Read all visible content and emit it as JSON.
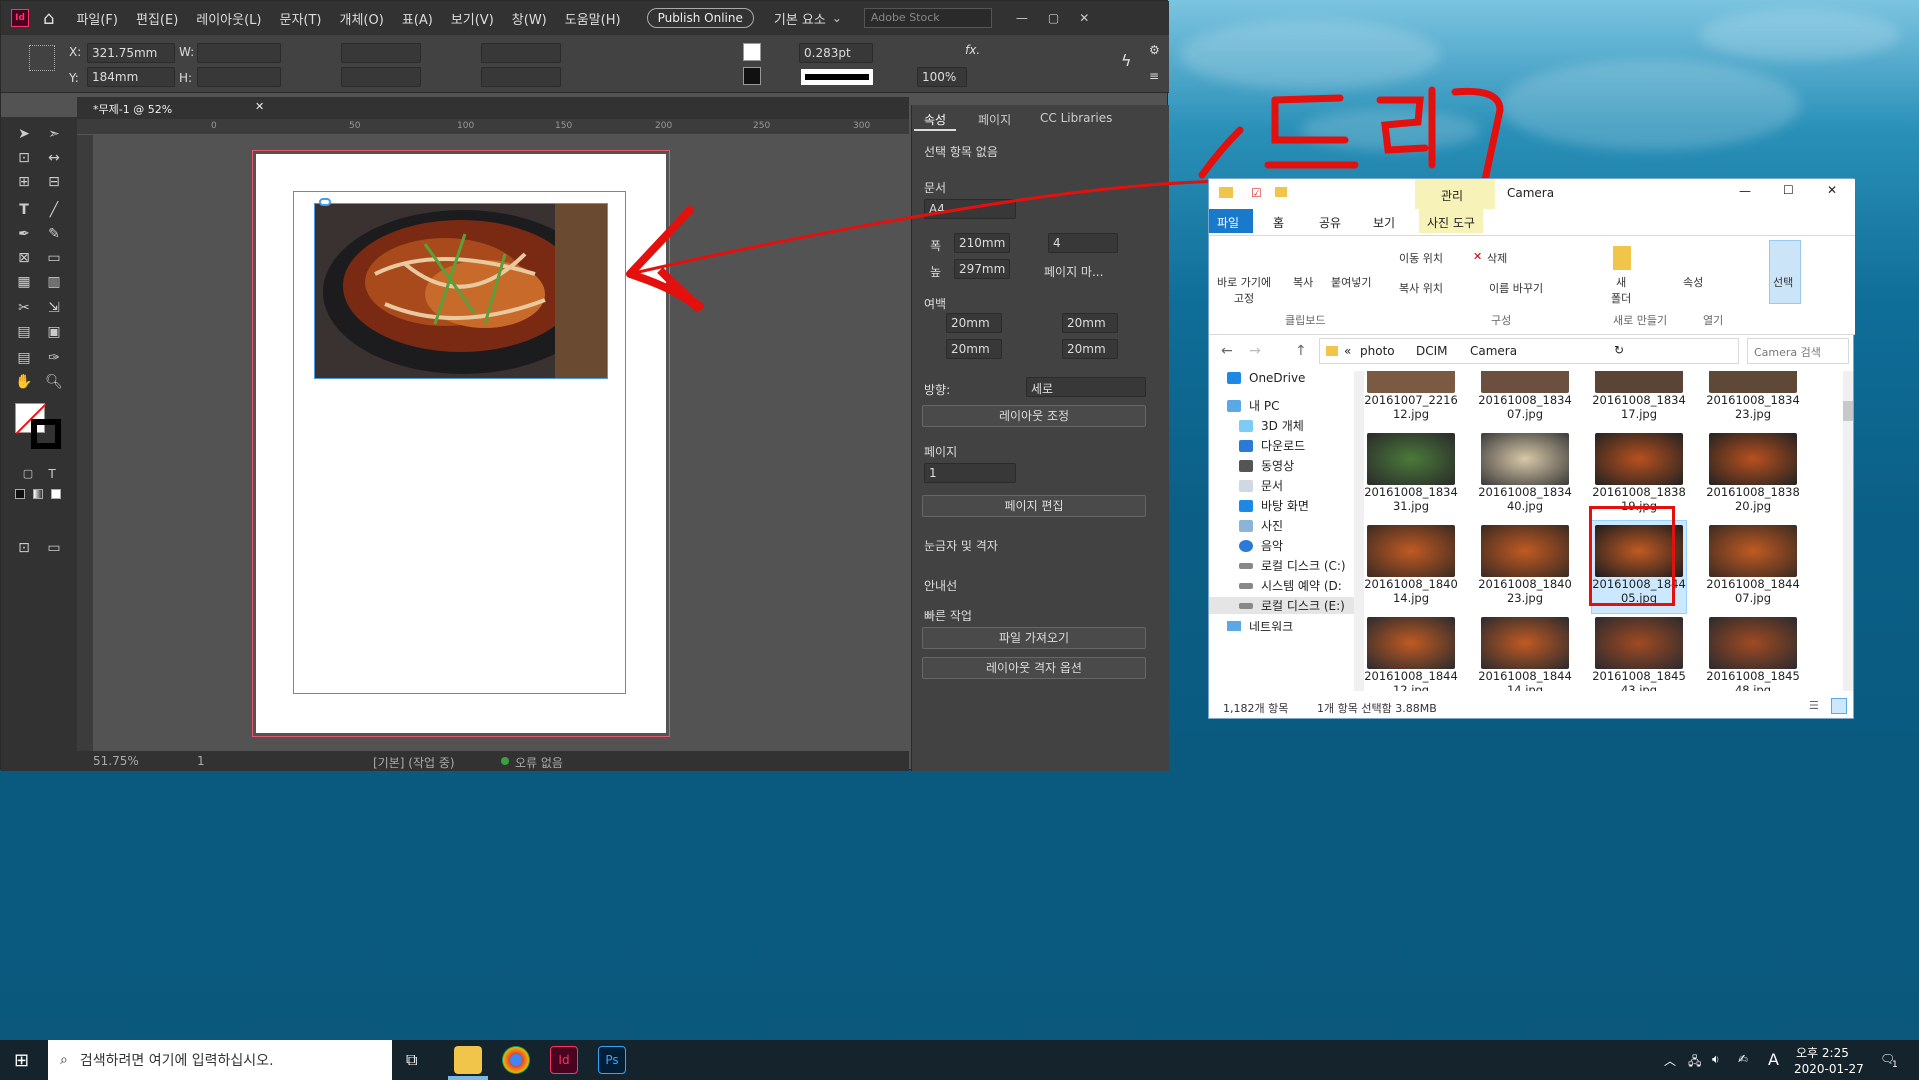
{
  "desktop": {
    "annotation": "드레그"
  },
  "indesign": {
    "menu": [
      "파일(F)",
      "편집(E)",
      "레이아웃(L)",
      "문자(T)",
      "개체(O)",
      "표(A)",
      "보기(V)",
      "창(W)",
      "도움말(H)"
    ],
    "publish": "Publish Online",
    "workspace": "기본 요소",
    "stock_search": "Adobe Stock",
    "control": {
      "x": "321.75mm",
      "y": "184mm",
      "w_label": "W:",
      "h_label": "H:",
      "x_label": "X:",
      "y_label": "Y:",
      "stroke": "0.283pt",
      "zoom": "100%"
    },
    "doc_tab": "*무제-1 @ 52%",
    "ruler_marks": [
      "0",
      "50",
      "100",
      "150",
      "200",
      "250",
      "300"
    ],
    "status": {
      "zoom": "51.75%",
      "page": "1",
      "style": "[기본] (작업 중)",
      "errors": "오류 없음"
    },
    "panel": {
      "tabs": [
        "속성",
        "페이지",
        "CC Libraries"
      ],
      "no_selection": "선택 항목 없음",
      "document": "문서",
      "size": "A4",
      "width_label": "폭",
      "width": "210mm",
      "height_label": "높",
      "height": "297mm",
      "pages_count": "4",
      "facing": "페이지 마...",
      "margins": "여백",
      "margin_values": [
        "20mm",
        "20mm",
        "20mm",
        "20mm"
      ],
      "orientation_label": "방향:",
      "orientation": "세로",
      "adjust_layout": "레이아웃 조정",
      "page_section": "페이지",
      "page_num": "1",
      "edit_page": "페이지 편집",
      "rulers_grids": "눈금자 및 격자",
      "guides": "안내선",
      "quick_actions": "빠른 작업",
      "import_file": "파일 가져오기",
      "layout_grid_options": "레이아웃 격자 옵션"
    }
  },
  "explorer": {
    "title": "Camera",
    "manage": "관리",
    "tabs": [
      "파일",
      "홈",
      "공유",
      "보기",
      "사진 도구"
    ],
    "ribbon": {
      "pin": "바로 가기에\n고정",
      "copy": "복사",
      "paste": "붙여넣기",
      "move_to": "이동 위치",
      "copy_to": "복사 위치",
      "delete": "삭제",
      "rename": "이름 바꾸기",
      "new_folder": "새\n폴더",
      "properties": "속성",
      "select": "선택",
      "group_clipboard": "클립보드",
      "group_organize": "구성",
      "group_new": "새로 만들기",
      "group_open": "열기"
    },
    "breadcrumb": [
      "«",
      "photo",
      "DCIM",
      "Camera"
    ],
    "search_placeholder": "Camera 검색",
    "nav": [
      "OneDrive",
      "내 PC",
      "3D 개체",
      "다운로드",
      "동영상",
      "문서",
      "바탕 화면",
      "사진",
      "음악",
      "로컬 디스크 (C:)",
      "시스템 예약 (D:",
      "로컬 디스크 (E:)",
      "네트워크"
    ],
    "files": [
      [
        "20161007_2216\n12.jpg",
        "20161008_1834\n07.jpg",
        "20161008_1834\n17.jpg",
        "20161008_1834\n23.jpg"
      ],
      [
        "20161008_1834\n31.jpg",
        "20161008_1834\n40.jpg",
        "20161008_1838\n19.jpg",
        "20161008_1838\n20.jpg"
      ],
      [
        "20161008_1840\n14.jpg",
        "20161008_1840\n23.jpg",
        "20161008_1844\n05.jpg",
        "20161008_1844\n07.jpg"
      ],
      [
        "20161008_1844\n12.jpg",
        "20161008_1844\n14.jpg",
        "20161008_1845\n43.jpg",
        "20161008_1845\n48.jpg"
      ]
    ],
    "status_count": "1,182개 항목",
    "status_selected": "1개 항목 선택함 3.88MB"
  },
  "taskbar": {
    "search": "검색하려면 여기에 입력하십시오.",
    "time": "오후 2:25",
    "date": "2020-01-27",
    "ime": "A",
    "notif": "1"
  },
  "colors": {
    "accent_red": "#e4100e",
    "id_magenta": "#ff3366",
    "selection": "#cce8ff"
  }
}
